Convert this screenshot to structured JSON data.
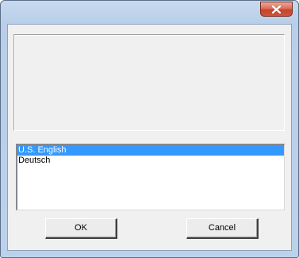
{
  "window": {
    "close_icon": "close-icon"
  },
  "languages": {
    "items": [
      "U.S. English",
      "Deutsch"
    ],
    "selected_index": 0
  },
  "buttons": {
    "ok_label": "OK",
    "cancel_label": "Cancel"
  },
  "colors": {
    "selection": "#3399ff",
    "close_button": "#c6452c"
  }
}
